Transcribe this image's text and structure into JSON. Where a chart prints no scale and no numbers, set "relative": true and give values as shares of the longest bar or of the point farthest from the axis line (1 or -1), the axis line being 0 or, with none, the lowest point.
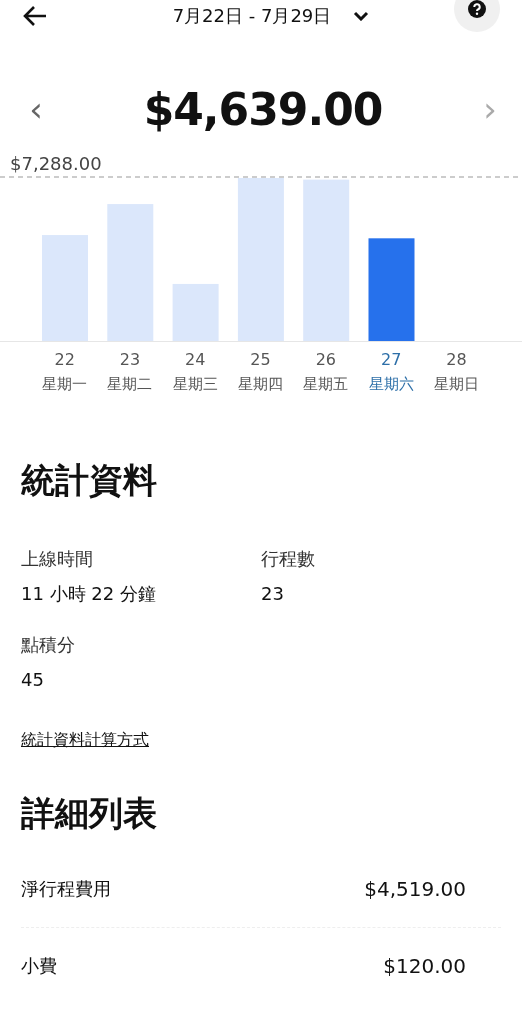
{
  "header": {
    "date_range": "7月22日 - 7月29日"
  },
  "summary": {
    "prev": "‹",
    "amount": "$4,639.00",
    "next": "›"
  },
  "chart": {
    "chart_data": {
      "type": "bar",
      "relative": true,
      "categories": [
        "22",
        "23",
        "24",
        "25",
        "26",
        "27",
        "28"
      ],
      "annotations": [
        {
          "text": "$7,288.00"
        }
      ],
      "series": [
        {
          "color": "#dbe7fb",
          "values": [
            0.65,
            0.84,
            0.35,
            1,
            0.99,
            null,
            null
          ]
        },
        {
          "color": "#2671ec",
          "values": [
            null,
            null,
            null,
            null,
            null,
            0.63,
            null
          ]
        }
      ]
    },
    "days": [
      {
        "weekday": "星期一",
        "selected": false
      },
      {
        "weekday": "星期二",
        "selected": false
      },
      {
        "weekday": "星期三",
        "selected": false
      },
      {
        "weekday": "星期四",
        "selected": false
      },
      {
        "weekday": "星期五",
        "selected": false
      },
      {
        "weekday": "星期六",
        "selected": true
      },
      {
        "weekday": "星期日",
        "selected": false
      }
    ]
  },
  "stats": {
    "title": "統計資料",
    "items": [
      {
        "label": "上線時間",
        "value": "11 小時 22 分鐘"
      },
      {
        "label": "行程數",
        "value": "23"
      },
      {
        "label": "點積分",
        "value": "45"
      }
    ],
    "link": "統計資料計算方式"
  },
  "details": {
    "title": "詳細列表",
    "rows": [
      {
        "label": "淨行程費用",
        "amount": "$4,519.00"
      },
      {
        "label": "小費",
        "amount": "$120.00"
      }
    ]
  }
}
